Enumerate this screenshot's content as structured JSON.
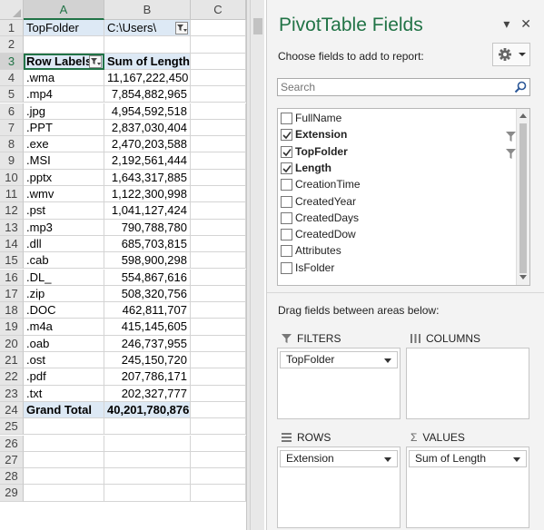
{
  "sheet": {
    "columns": [
      "A",
      "B",
      "C"
    ],
    "row_numbers": [
      "1",
      "2",
      "3",
      "4",
      "5",
      "6",
      "7",
      "8",
      "9",
      "10",
      "11",
      "12",
      "13",
      "14",
      "15",
      "16",
      "17",
      "18",
      "19",
      "20",
      "21",
      "22",
      "23",
      "24",
      "25",
      "26",
      "27",
      "28",
      "29"
    ],
    "filter_label": "TopFolder",
    "filter_value": "C:\\Users\\",
    "header_row_labels": "Row Labels",
    "header_sum": "Sum of Length",
    "rows": [
      {
        "label": ".wma",
        "value": "11,167,222,450"
      },
      {
        "label": ".mp4",
        "value": "7,854,882,965"
      },
      {
        "label": ".jpg",
        "value": "4,954,592,518"
      },
      {
        "label": ".PPT",
        "value": "2,837,030,404"
      },
      {
        "label": ".exe",
        "value": "2,470,203,588"
      },
      {
        "label": ".MSI",
        "value": "2,192,561,444"
      },
      {
        "label": ".pptx",
        "value": "1,643,317,885"
      },
      {
        "label": ".wmv",
        "value": "1,122,300,998"
      },
      {
        "label": ".pst",
        "value": "1,041,127,424"
      },
      {
        "label": ".mp3",
        "value": "790,788,780"
      },
      {
        "label": ".dll",
        "value": "685,703,815"
      },
      {
        "label": ".cab",
        "value": "598,900,298"
      },
      {
        "label": ".DL_",
        "value": "554,867,616"
      },
      {
        "label": ".zip",
        "value": "508,320,756"
      },
      {
        "label": ".DOC",
        "value": "462,811,707"
      },
      {
        "label": ".m4a",
        "value": "415,145,605"
      },
      {
        "label": ".oab",
        "value": "246,737,955"
      },
      {
        "label": ".ost",
        "value": "245,150,720"
      },
      {
        "label": ".pdf",
        "value": "207,786,171"
      },
      {
        "label": ".txt",
        "value": "202,327,777"
      }
    ],
    "grand_total_label": "Grand Total",
    "grand_total_value": "40,201,780,876"
  },
  "pane": {
    "title": "PivotTable Fields",
    "subtitle": "Choose fields to add to report:",
    "search_placeholder": "Search",
    "fields": [
      {
        "name": "FullName",
        "checked": false,
        "bold": false,
        "filtered": false
      },
      {
        "name": "Extension",
        "checked": true,
        "bold": true,
        "filtered": true
      },
      {
        "name": "TopFolder",
        "checked": true,
        "bold": true,
        "filtered": true
      },
      {
        "name": "Length",
        "checked": true,
        "bold": true,
        "filtered": false
      },
      {
        "name": "CreationTime",
        "checked": false,
        "bold": false,
        "filtered": false
      },
      {
        "name": "CreatedYear",
        "checked": false,
        "bold": false,
        "filtered": false
      },
      {
        "name": "CreatedDays",
        "checked": false,
        "bold": false,
        "filtered": false
      },
      {
        "name": "CreatedDow",
        "checked": false,
        "bold": false,
        "filtered": false
      },
      {
        "name": "Attributes",
        "checked": false,
        "bold": false,
        "filtered": false
      },
      {
        "name": "IsFolder",
        "checked": false,
        "bold": false,
        "filtered": false
      }
    ],
    "drag_label": "Drag fields between areas below:",
    "areas": {
      "filters": {
        "title": "FILTERS",
        "items": [
          "TopFolder"
        ]
      },
      "columns": {
        "title": "COLUMNS",
        "items": []
      },
      "rows": {
        "title": "ROWS",
        "items": [
          "Extension"
        ]
      },
      "values": {
        "title": "VALUES",
        "items": [
          "Sum of Length"
        ]
      }
    }
  },
  "colors": {
    "accent": "#217346",
    "pivot_header": "#dde9f5"
  },
  "icons": [
    "dropdown-icon",
    "close-icon",
    "gear-icon",
    "search-icon",
    "filter-icon",
    "checkbox-icon",
    "rows-icon",
    "columns-icon",
    "sigma-icon"
  ]
}
